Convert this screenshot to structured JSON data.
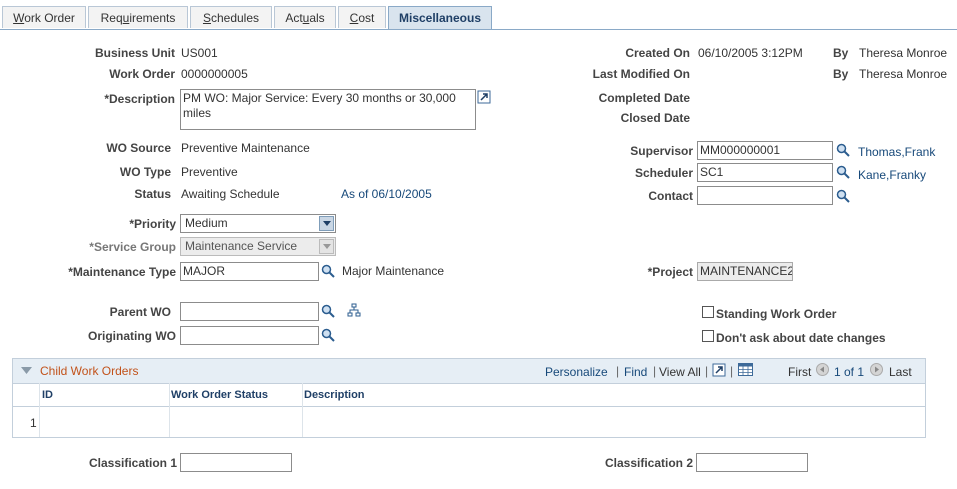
{
  "tabs": [
    {
      "pre": "",
      "u": "W",
      "post": "ork Order"
    },
    {
      "pre": "Req",
      "u": "u",
      "post": "irements"
    },
    {
      "pre": "",
      "u": "S",
      "post": "chedules"
    },
    {
      "pre": "Act",
      "u": "u",
      "post": "als"
    },
    {
      "pre": "",
      "u": "C",
      "post": "ost"
    },
    {
      "pre": "Miscellaneous",
      "u": "",
      "post": ""
    }
  ],
  "header": {
    "business_unit_label": "Business Unit",
    "business_unit": "US001",
    "work_order_label": "Work Order",
    "work_order": "0000000005",
    "description_label": "*Description",
    "description": "PM WO: Major Service: Every 30 months or 30,000 miles",
    "created_on_label": "Created On",
    "created_on": "06/10/2005  3:12PM",
    "by_label_1": "By",
    "created_by": "Theresa Monroe",
    "last_modified_label": "Last Modified On",
    "by_label_2": "By",
    "modified_by": "Theresa Monroe",
    "completed_label": "Completed Date",
    "closed_label": "Closed Date"
  },
  "details": {
    "wo_source_label": "WO Source",
    "wo_source": "Preventive Maintenance",
    "wo_type_label": "WO Type",
    "wo_type": "Preventive",
    "status_label": "Status",
    "status": "Awaiting Schedule",
    "status_date": "As of 06/10/2005",
    "priority_label": "*Priority",
    "priority": "Medium",
    "service_group_label": "*Service Group",
    "service_group": "Maintenance Service",
    "maint_type_label": "*Maintenance Type",
    "maint_type": "MAJOR",
    "maint_type_desc": "Major Maintenance",
    "supervisor_label": "Supervisor",
    "supervisor": "MM000000001",
    "supervisor_name": "Thomas,Frank",
    "scheduler_label": "Scheduler",
    "scheduler": "SC1",
    "scheduler_name": "Kane,Franky",
    "contact_label": "Contact",
    "contact": "",
    "project_label": "*Project",
    "project": "MAINTENANCE2",
    "parent_wo_label": "Parent WO",
    "parent_wo": "",
    "originating_wo_label": "Originating WO",
    "originating_wo": "",
    "standing_wo_label": "Standing Work Order",
    "dont_ask_label": "Don't ask about date changes"
  },
  "grid": {
    "title": "Child Work Orders",
    "personalize": "Personalize",
    "find": "Find",
    "view_all": "View All",
    "first": "First",
    "page_info": "1 of 1",
    "last": "Last",
    "columns": [
      "ID",
      "Work Order Status",
      "Description"
    ],
    "rows": [
      {
        "num": "1",
        "id": "",
        "status": "",
        "description": ""
      }
    ]
  },
  "classification": {
    "c1_label": "Classification 1",
    "c1": "",
    "c2_label": "Classification 2",
    "c2": ""
  },
  "colors": {
    "link": "#17497a",
    "grid_title": "#c2521a",
    "tab_active": "#d9e4ee"
  }
}
